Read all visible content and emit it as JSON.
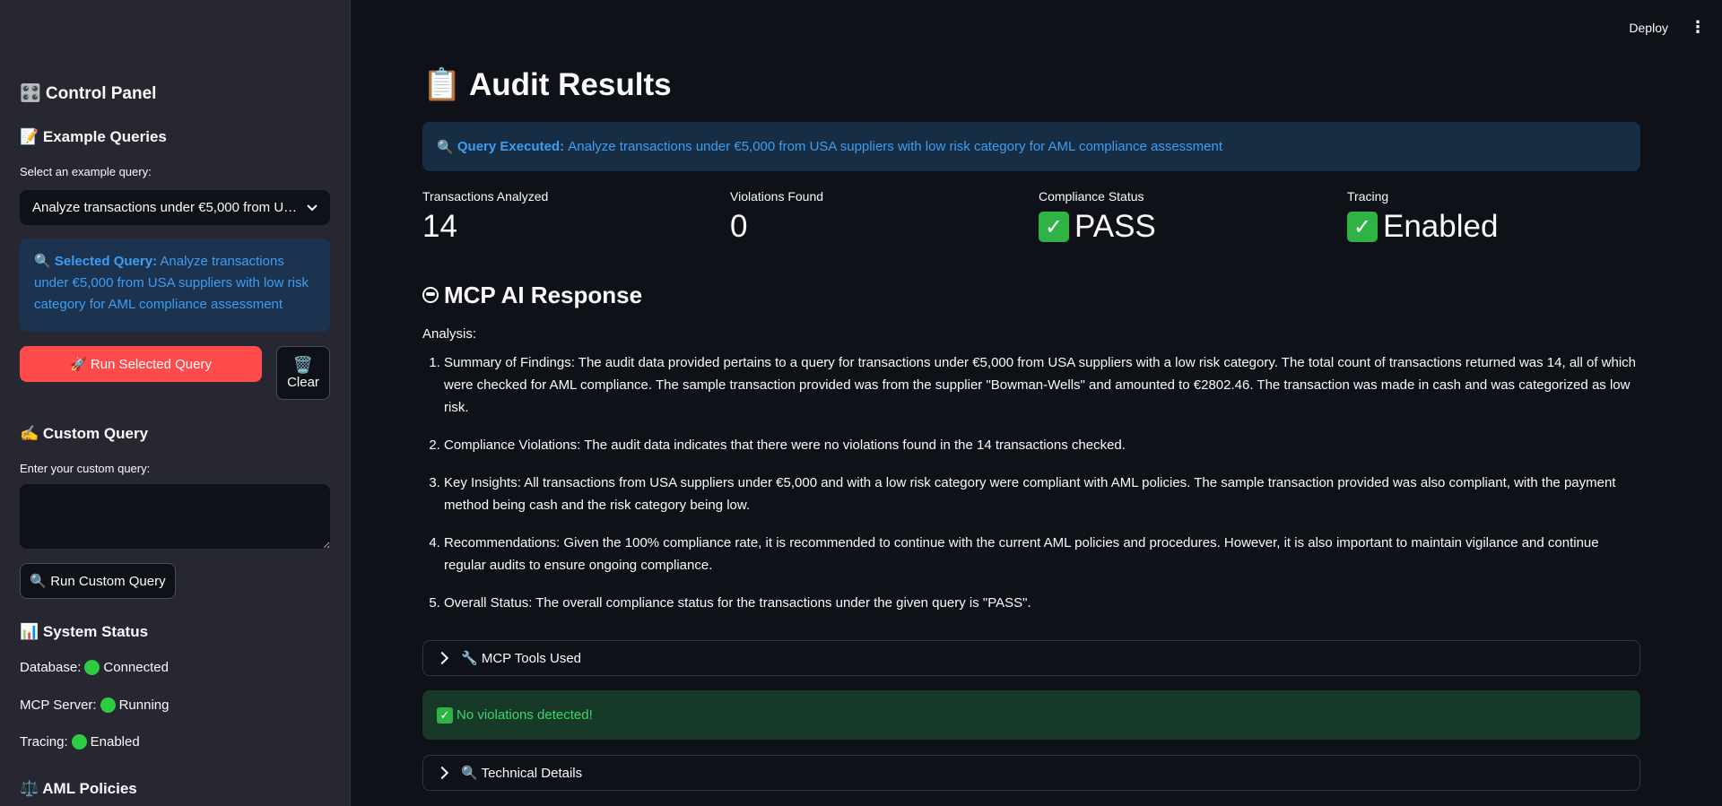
{
  "sidebar": {
    "control_panel": "🎛️ Control Panel",
    "example_queries": "📝 Example Queries",
    "select_label": "Select an example query:",
    "select_value": "Analyze transactions under €5,000 from USA suppliers with low risk category for AML compliance assessment",
    "selected_query_label": "Selected Query:",
    "selected_query_text": "Analyze transactions under €5,000 from USA suppliers with low risk category for AML compliance assessment",
    "run_selected": "🚀 Run Selected Query",
    "clear_icon": "🗑️",
    "clear_label": "Clear",
    "custom_query": "✍️ Custom Query",
    "custom_label": "Enter your custom query:",
    "custom_value": "",
    "run_custom": "🔍 Run Custom Query",
    "system_status": "📊 System Status",
    "status": [
      {
        "label": "Database:",
        "value": "Connected"
      },
      {
        "label": "MCP Server:",
        "value": "Running"
      },
      {
        "label": "Tracing:",
        "value": "Enabled"
      }
    ],
    "aml_policies": "⚖️ AML Policies"
  },
  "toolbar": {
    "deploy": "Deploy"
  },
  "main": {
    "title": "📋 Audit Results",
    "query_label": "Query Executed:",
    "query_text": "Analyze transactions under €5,000 from USA suppliers with low risk category for AML compliance assessment",
    "metrics": [
      {
        "label": "Transactions Analyzed",
        "value": "14"
      },
      {
        "label": "Violations Found",
        "value": "0"
      },
      {
        "label": "Compliance Status",
        "value": "PASS"
      },
      {
        "label": "Tracing",
        "value": "Enabled"
      }
    ],
    "response_title": "MCP AI Response",
    "analysis_label": "Analysis:",
    "findings": [
      "Summary of Findings: The audit data provided pertains to a query for transactions under €5,000 from USA suppliers with a low risk category. The total count of transactions returned was 14, all of which were checked for AML compliance. The sample transaction provided was from the supplier \"Bowman-Wells\" and amounted to €2802.46. The transaction was made in cash and was categorized as low risk.",
      "Compliance Violations: The audit data indicates that there were no violations found in the 14 transactions checked.",
      "Key Insights: All transactions from USA suppliers under €5,000 and with a low risk category were compliant with AML policies. The sample transaction provided was also compliant, with the payment method being cash and the risk category being low.",
      "Recommendations: Given the 100% compliance rate, it is recommended to continue with the current AML policies and procedures. However, it is also important to maintain vigilance and continue regular audits to ensure ongoing compliance.",
      "Overall Status: The overall compliance status for the transactions under the given query is \"PASS\"."
    ],
    "tools_expander": "🔧 MCP Tools Used",
    "success_text": "No violations detected!",
    "technical_expander": "🔍 Technical Details"
  }
}
